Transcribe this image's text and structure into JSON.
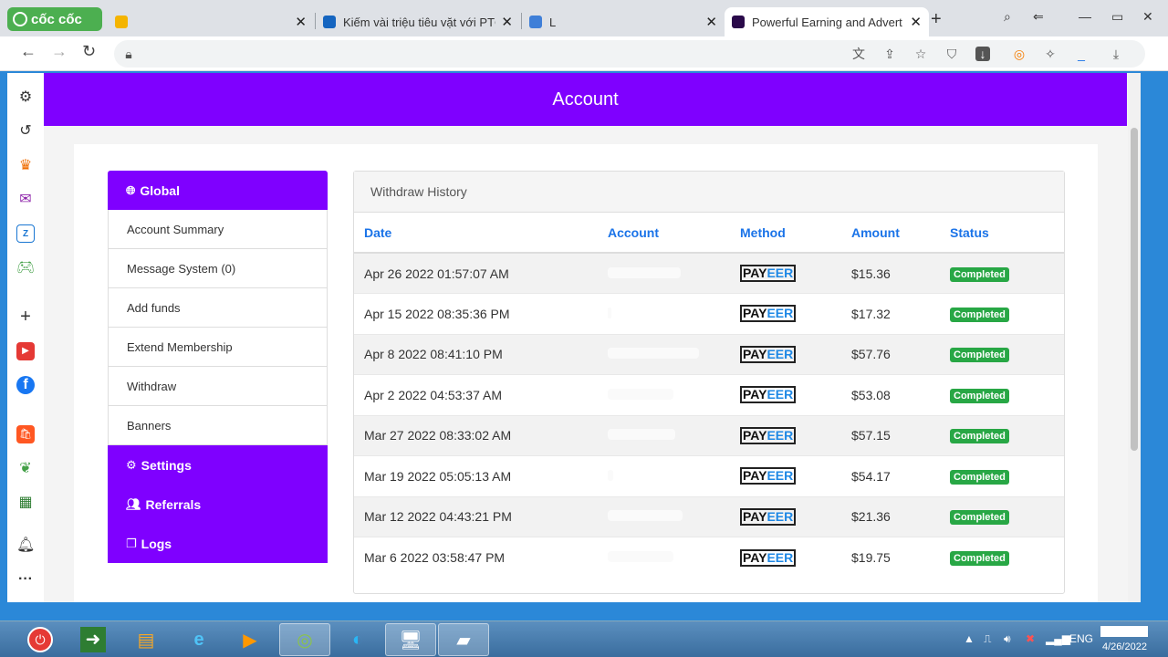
{
  "browser": {
    "brand": "cốc cốc",
    "tabs": [
      {
        "title": "",
        "active": false
      },
      {
        "title": "Kiếm vài triệu tiêu vặt với PTC",
        "active": false
      },
      {
        "title": "L",
        "active": false
      },
      {
        "title": "Powerful Earning and Advert",
        "active": true
      }
    ],
    "url": ""
  },
  "page": {
    "title": "Account"
  },
  "menu": {
    "global": "Global",
    "items": [
      "Account Summary",
      "Message System (0)",
      "Add funds",
      "Extend Membership",
      "Withdraw",
      "Banners"
    ],
    "settings": "Settings",
    "referrals": "Referrals",
    "logs": "Logs"
  },
  "withdraw": {
    "title": "Withdraw History",
    "columns": [
      "Date",
      "Account",
      "Method",
      "Amount",
      "Status"
    ],
    "method_logo": {
      "pay": "PAY",
      "eer": "EER"
    },
    "rows": [
      {
        "date": "Apr 26 2022 01:57:07 AM",
        "account": "",
        "amount": "$15.36",
        "status": "Completed"
      },
      {
        "date": "Apr 15 2022 08:35:36 PM",
        "account": "",
        "amount": "$17.32",
        "status": "Completed"
      },
      {
        "date": "Apr 8 2022 08:41:10 PM",
        "account": "",
        "amount": "$57.76",
        "status": "Completed"
      },
      {
        "date": "Apr 2 2022 04:53:37 AM",
        "account": "",
        "amount": "$53.08",
        "status": "Completed"
      },
      {
        "date": "Mar 27 2022 08:33:02 AM",
        "account": "",
        "amount": "$57.15",
        "status": "Completed"
      },
      {
        "date": "Mar 19 2022 05:05:13 AM",
        "account": "",
        "amount": "$54.17",
        "status": "Completed"
      },
      {
        "date": "Mar 12 2022 04:43:21 PM",
        "account": "",
        "amount": "$21.36",
        "status": "Completed"
      },
      {
        "date": "Mar 6 2022 03:58:47 PM",
        "account": "",
        "amount": "$19.75",
        "status": "Completed"
      }
    ]
  },
  "taskbar": {
    "language": "ENG",
    "date": "4/26/2022"
  },
  "colors": {
    "accent": "#7f00ff",
    "link": "#1a73e8",
    "success": "#28a745"
  }
}
